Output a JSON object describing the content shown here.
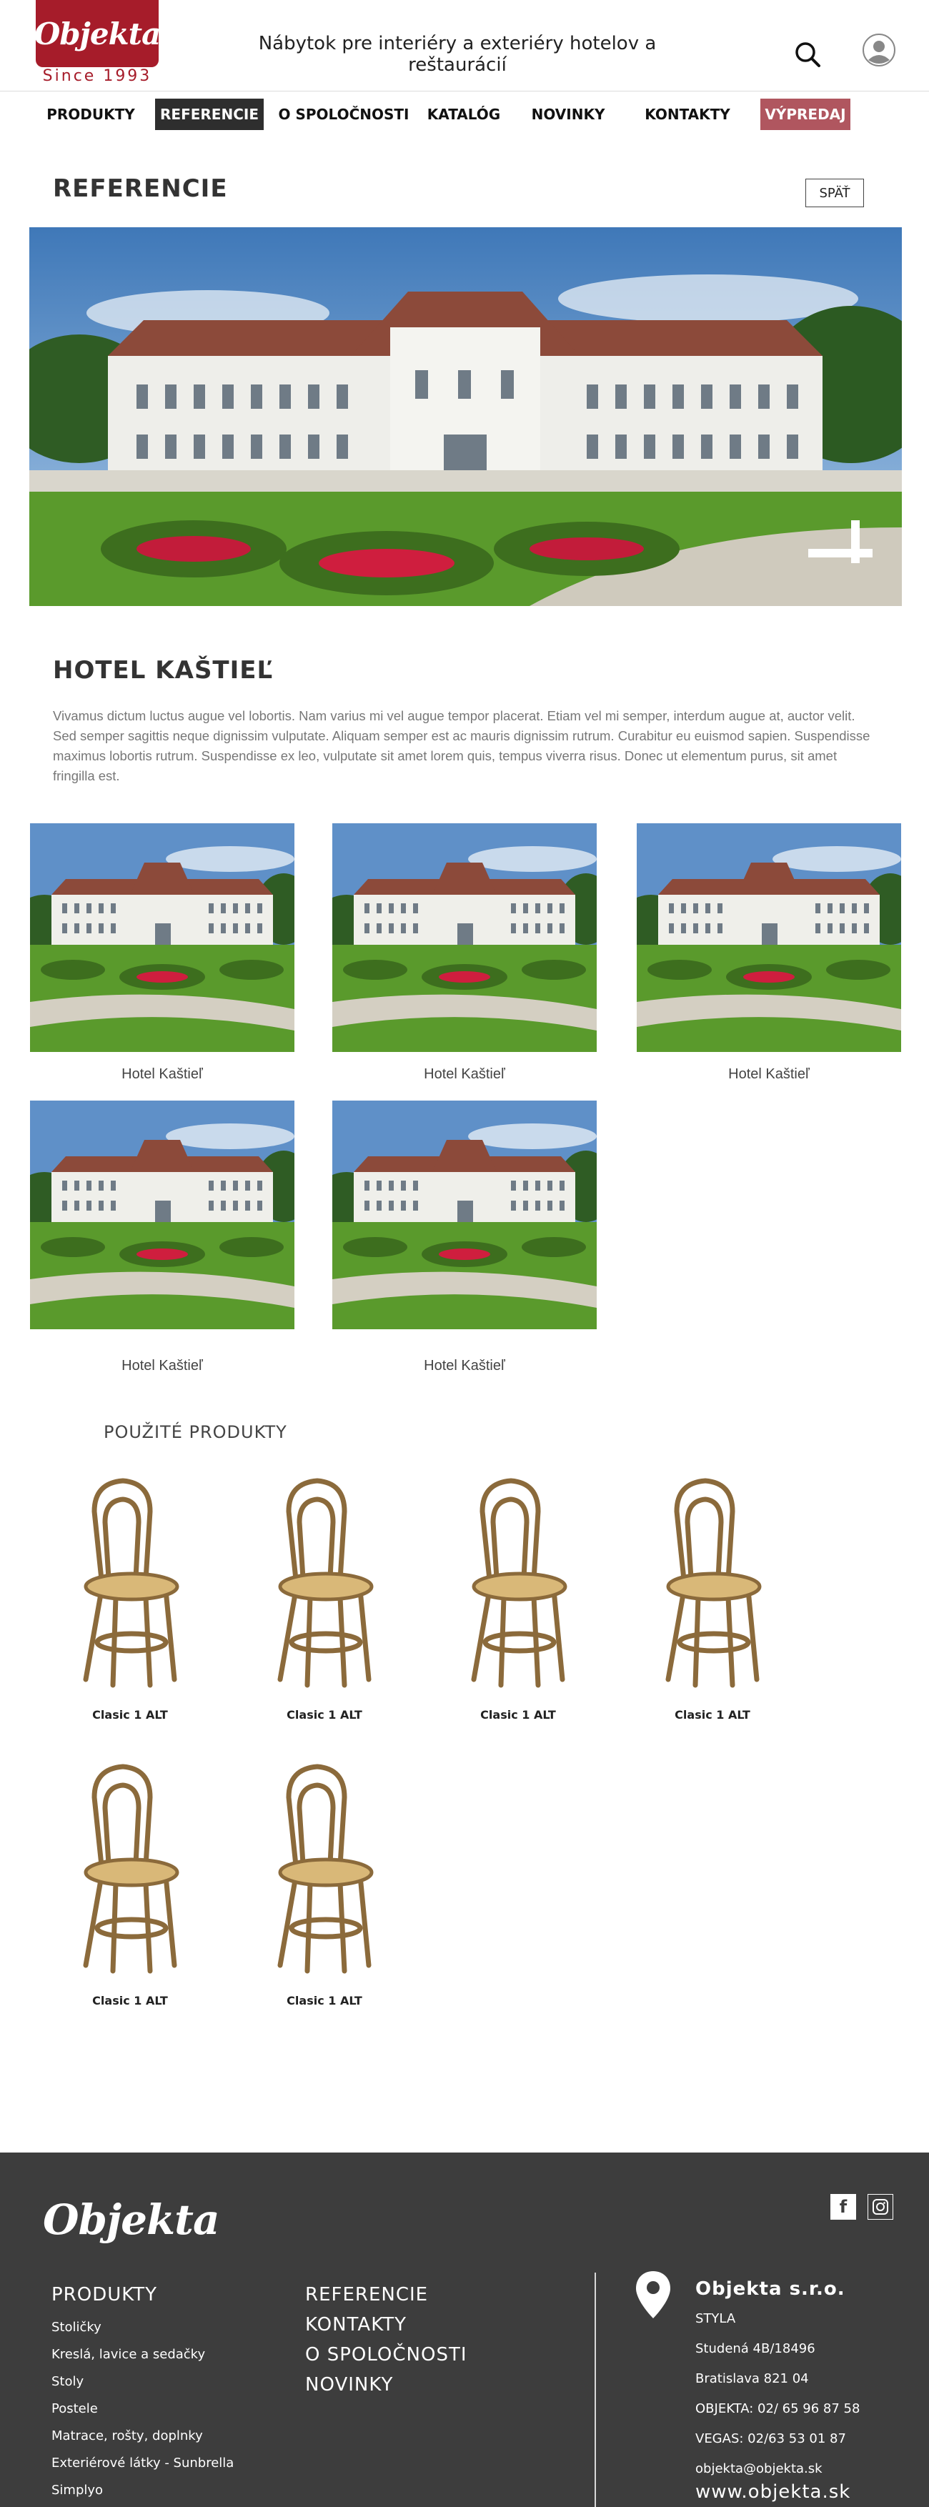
{
  "header": {
    "logo": "Objekta",
    "since": "Since 1993",
    "tagline": "Nábytok pre interiéry a exteriéry hotelov a reštaurácií"
  },
  "nav": {
    "items": [
      {
        "label": "PRODUKTY"
      },
      {
        "label": "REFERENCIE"
      },
      {
        "label": "O SPOLOČNOSTI"
      },
      {
        "label": "KATALÓG"
      },
      {
        "label": "NOVINKY"
      },
      {
        "label": "KONTAKTY"
      },
      {
        "label": "VÝPREDAJ"
      }
    ]
  },
  "page": {
    "title": "REFERENCIE",
    "back_label": "SPÄŤ",
    "hotel_title": "HOTEL KAŠTIEĽ",
    "description": "Vivamus dictum luctus augue vel lobortis. Nam varius mi vel augue tempor placerat. Etiam vel mi semper, interdum augue at, auctor velit. Sed semper sagittis neque dignissim vulputate. Aliquam semper est ac mauris dignissim rutrum. Curabitur eu euismod sapien. Suspendisse maximus lobortis rutrum. Suspendisse ex leo, vulputate sit amet lorem quis, tempus viverra risus. Donec ut elementum purus, sit amet fringilla est."
  },
  "gallery": [
    {
      "caption": "Hotel Kaštieľ"
    },
    {
      "caption": "Hotel Kaštieľ"
    },
    {
      "caption": "Hotel Kaštieľ"
    },
    {
      "caption": "Hotel Kaštieľ"
    },
    {
      "caption": "Hotel Kaštieľ"
    }
  ],
  "used_products": {
    "title": "POUŽITÉ PRODUKTY",
    "items": [
      {
        "name": "Clasic 1 ALT"
      },
      {
        "name": "Clasic 1 ALT"
      },
      {
        "name": "Clasic 1 ALT"
      },
      {
        "name": "Clasic 1 ALT"
      },
      {
        "name": "Clasic 1 ALT"
      },
      {
        "name": "Clasic 1 ALT"
      }
    ]
  },
  "footer": {
    "logo": "Objekta",
    "col1": {
      "heading": "PRODUKTY",
      "links": [
        "Stoličky",
        "Kreslá, lavice a sedačky",
        "Stoly",
        "Postele",
        "Matrace, rošty, doplnky",
        "Exteriérové látky - Sunbrella",
        "Simplyo"
      ]
    },
    "col2": [
      "REFERENCIE",
      "KONTAKTY",
      "O SPOLOČNOSTI",
      "NOVINKY"
    ],
    "contact": {
      "company": "Objekta s.r.o.",
      "lines": [
        "STYLA",
        "Studená 4B/18496",
        "Bratislava 821 04",
        "OBJEKTA: 02/ 65 96 87 58",
        "VEGAS: 02/63 53 01 87",
        "objekta@objekta.sk"
      ],
      "web": "www.objekta.sk"
    },
    "social": [
      "facebook-icon",
      "instagram-icon"
    ]
  },
  "colors": {
    "brand_red": "#a61c2a",
    "nav_active": "#2e2e2e",
    "sale": "#b0565f",
    "footer_bg": "#3d3d3d"
  }
}
